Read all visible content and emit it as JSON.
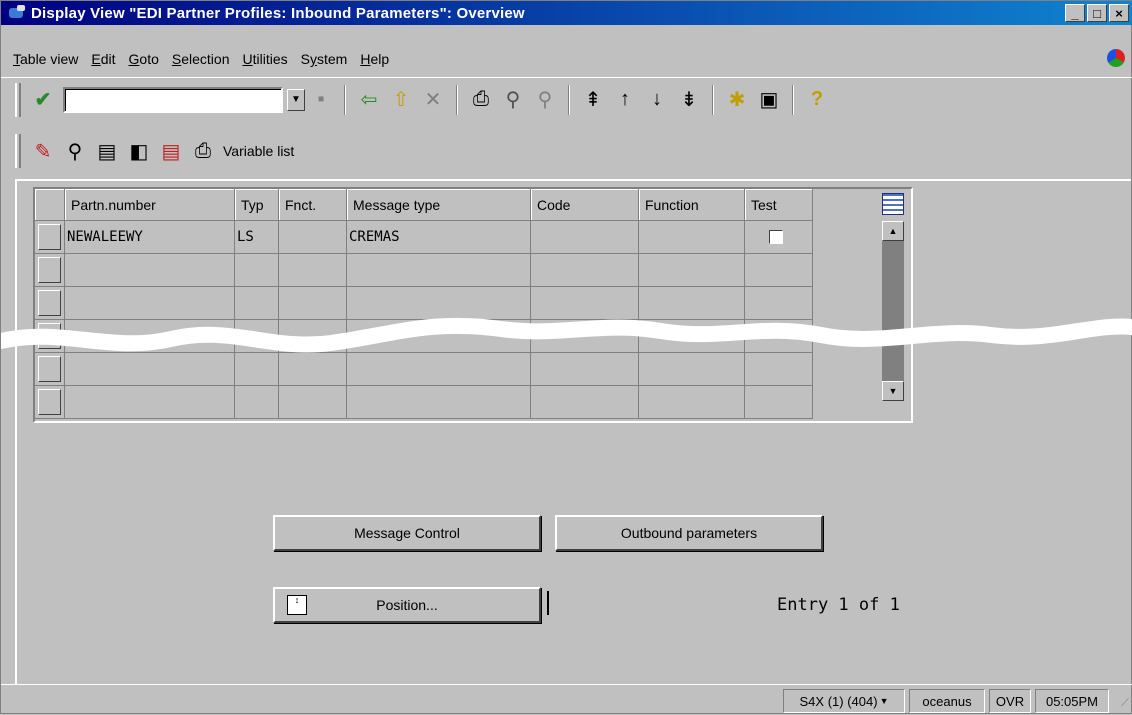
{
  "window": {
    "title": "Display View \"EDI Partner Profiles: Inbound Parameters\": Overview",
    "min": "_",
    "max": "□",
    "close": "×"
  },
  "menu": [
    "Table view",
    "Edit",
    "Goto",
    "Selection",
    "Utilities",
    "System",
    "Help"
  ],
  "menu_underline": [
    "T",
    "E",
    "G",
    "S",
    "U",
    "y",
    "H"
  ],
  "toolbar": {
    "command_field_value": "",
    "variable_list_label": "Variable list"
  },
  "grid": {
    "columns": [
      "Partn.number",
      "Typ",
      "Fnct.",
      "Message type",
      "Code",
      "Function",
      "Test"
    ],
    "rows": [
      {
        "partner": "NEWALEEWY",
        "type": "LS",
        "function": "",
        "message_type": "CREMAS",
        "code": "",
        "msg_function": "",
        "test": false
      },
      {
        "partner": "",
        "type": "",
        "function": "",
        "message_type": "",
        "code": "",
        "msg_function": "",
        "test": false
      },
      {
        "partner": "",
        "type": "",
        "function": "",
        "message_type": "",
        "code": "",
        "msg_function": "",
        "test": false
      },
      {
        "partner": "",
        "type": "",
        "function": "",
        "message_type": "",
        "code": "",
        "msg_function": "",
        "test": false
      },
      {
        "partner": "",
        "type": "",
        "function": "",
        "message_type": "",
        "code": "",
        "msg_function": "",
        "test": false
      },
      {
        "partner": "",
        "type": "",
        "function": "",
        "message_type": "",
        "code": "",
        "msg_function": "",
        "test": false
      }
    ]
  },
  "buttons": {
    "message_control": "Message Control",
    "outbound_parameters": "Outbound parameters",
    "position": "Position..."
  },
  "entry_text": "Entry 1 of 1",
  "status": {
    "system": "S4X (1) (404)",
    "server": "oceanus",
    "mode": "OVR",
    "time": "05:05PM"
  }
}
